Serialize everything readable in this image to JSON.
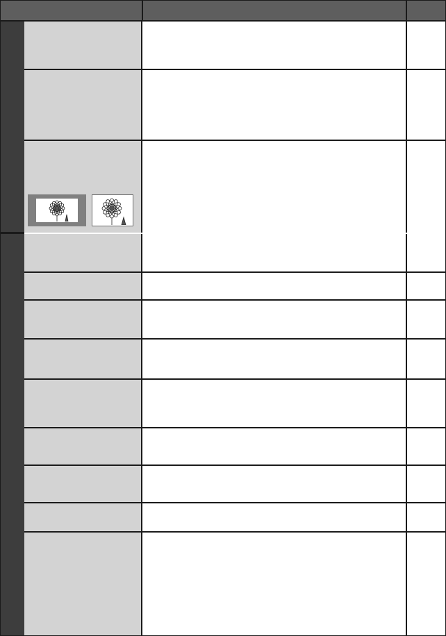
{
  "header": {
    "col1": "",
    "col2": "",
    "col3": ""
  },
  "sections": [
    {
      "name": "",
      "rows": [
        {
          "label": "",
          "desc": "",
          "ref": ""
        },
        {
          "label": "",
          "desc": "",
          "ref": ""
        },
        {
          "label": "",
          "desc": "",
          "ref": ""
        }
      ]
    },
    {
      "name": "",
      "rows": [
        {
          "label": "",
          "desc": "",
          "ref": ""
        },
        {
          "label": "",
          "desc": "",
          "ref": ""
        },
        {
          "label": "",
          "desc": "",
          "ref": ""
        },
        {
          "label": "",
          "desc": "",
          "ref": ""
        },
        {
          "label": "",
          "desc": "",
          "ref": ""
        },
        {
          "label": "",
          "desc": "",
          "ref": ""
        },
        {
          "label": "",
          "desc": "",
          "ref": ""
        },
        {
          "label": "",
          "desc": "",
          "ref": ""
        },
        {
          "label": "",
          "desc": "",
          "ref": ""
        }
      ]
    }
  ],
  "icons": [
    "flower-illustration-icon",
    "flower-illustration-icon"
  ],
  "colors": {
    "header": "#5e5e5e",
    "band": "#3d3d3d",
    "label_cell": "#d3d3d3",
    "line": "#1a1a1a"
  }
}
